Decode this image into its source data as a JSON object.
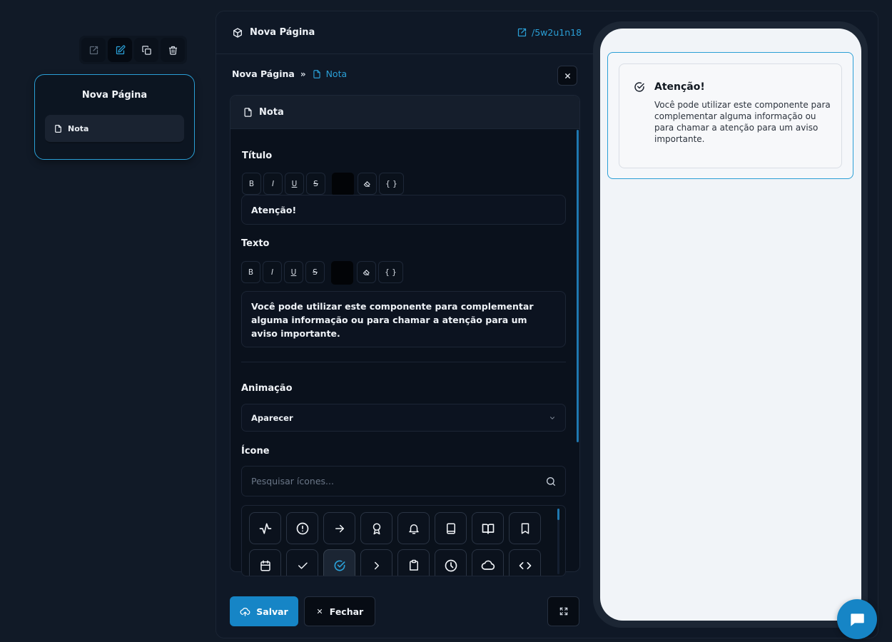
{
  "node": {
    "toolbar": {
      "open": "external-link-icon",
      "edit": "edit-icon",
      "duplicate": "copy-icon",
      "delete": "trash-icon"
    },
    "title": "Nova Página",
    "item_label": "Nota"
  },
  "editor": {
    "header_title": "Nova Página",
    "link_text": "/5w2u1n18",
    "breadcrumb": {
      "root": "Nova Página",
      "separator": "»",
      "current": "Nota"
    },
    "card_title": "Nota",
    "fields": {
      "title_label": "Título",
      "title_value": "Atenção!",
      "text_label": "Texto",
      "text_value": "Você pode utilizar este componente para complementar alguma informação ou para chamar a atenção para um aviso importante.",
      "animation_label": "Animação",
      "animation_value": "Aparecer",
      "icon_label": "Ícone",
      "icon_search_placeholder": "Pesquisar ícones..."
    },
    "format_buttons": [
      "B",
      "I",
      "U",
      "S",
      "",
      "eraser-icon",
      "{ }"
    ],
    "icons": [
      "activity-icon",
      "alert-circle-icon",
      "arrow-right-icon",
      "award-icon",
      "bell-icon",
      "book-icon",
      "book-open-icon",
      "bookmark-icon",
      "calendar-icon",
      "check-icon",
      "circle-check-icon",
      "chevron-right-icon",
      "clipboard-icon",
      "clock-icon",
      "cloud-icon",
      "code-icon"
    ],
    "selected_icon": "circle-check-icon",
    "footer": {
      "save_label": "Salvar",
      "close_label": "Fechar"
    }
  },
  "preview": {
    "title": "Atenção!",
    "text": "Você pode utilizar este componente para complementar alguma informação ou para chamar a atenção para um aviso importante.",
    "icon": "circle-check-icon"
  },
  "colors": {
    "accent": "#2a9fd6",
    "save_button": "#1685c6",
    "background": "#111a27",
    "preview_screen": "#f1f4f8"
  }
}
